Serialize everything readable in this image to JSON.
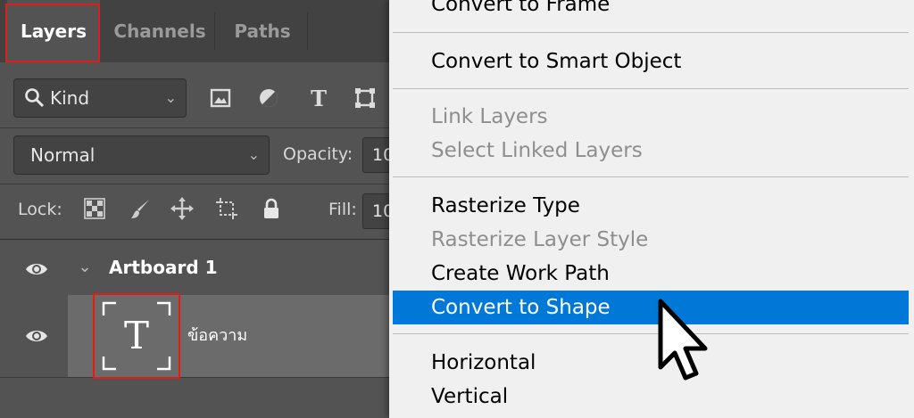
{
  "layers_panel": {
    "tabs": [
      {
        "label": "Layers",
        "active": true
      },
      {
        "label": "Channels",
        "active": false
      },
      {
        "label": "Paths",
        "active": false
      }
    ],
    "filter": {
      "label": "Kind",
      "icons": [
        "search-icon",
        "image-filter-icon",
        "adjustment-filter-icon",
        "type-filter-icon",
        "shape-filter-icon"
      ]
    },
    "blend": {
      "mode": "Normal",
      "opacity_label": "Opacity:",
      "opacity_value": "10"
    },
    "lock": {
      "label": "Lock:",
      "icons": [
        "lock-transparent-pixels-icon",
        "lock-image-pixels-icon",
        "lock-position-icon",
        "lock-artboard-icon",
        "lock-all-icon"
      ],
      "fill_label": "Fill:",
      "fill_value": "10"
    },
    "layers": [
      {
        "name": "Artboard 1",
        "type": "artboard",
        "visible": true,
        "expanded": true
      },
      {
        "name": "ข้อความ",
        "type": "text",
        "visible": true,
        "thumb_glyph": "T"
      }
    ]
  },
  "context_menu": {
    "items": [
      {
        "label": "Convert to Frame",
        "state": "enabled"
      },
      {
        "separator": true
      },
      {
        "label": "Convert to Smart Object",
        "state": "enabled"
      },
      {
        "separator": true
      },
      {
        "label": "Link Layers",
        "state": "disabled"
      },
      {
        "label": "Select Linked Layers",
        "state": "disabled"
      },
      {
        "separator": true
      },
      {
        "label": "Rasterize Type",
        "state": "enabled"
      },
      {
        "label": "Rasterize Layer Style",
        "state": "disabled"
      },
      {
        "label": "Create Work Path",
        "state": "enabled"
      },
      {
        "label": "Convert to Shape",
        "state": "selected"
      },
      {
        "separator": true
      },
      {
        "label": "Horizontal",
        "state": "enabled"
      },
      {
        "label": "Vertical",
        "state": "enabled"
      }
    ]
  },
  "colors": {
    "panel_bg": "#535353",
    "tab_bar_bg": "#424242",
    "highlight_border": "#e21b1b",
    "menu_bg": "#f0f0f0",
    "menu_selected": "#0078d7"
  }
}
